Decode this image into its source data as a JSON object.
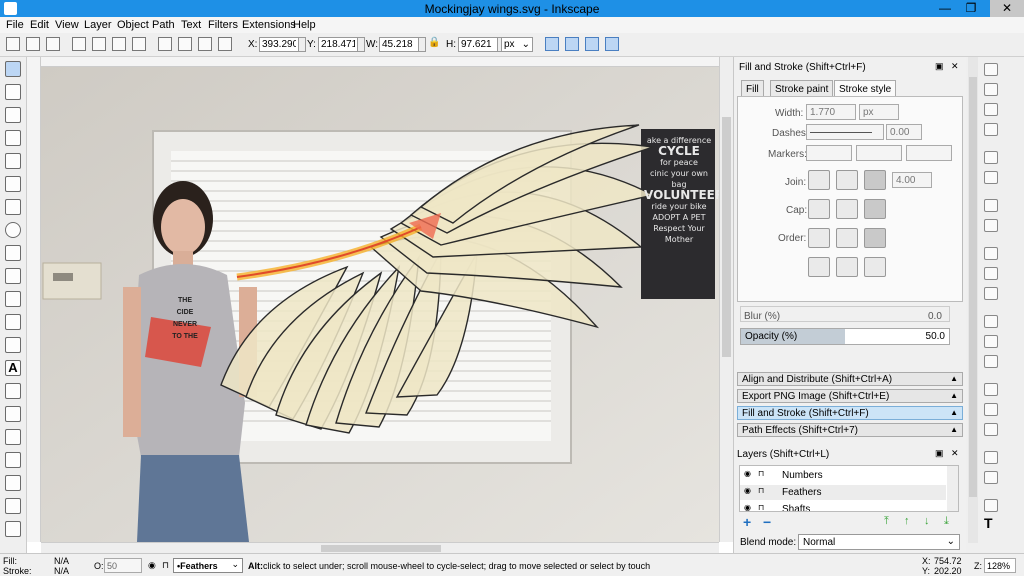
{
  "window": {
    "title": "Mockingjay wings.svg - Inkscape",
    "minimize": "—",
    "maximize": "❐",
    "close": "✕"
  },
  "menu": [
    "File",
    "Edit",
    "View",
    "Layer",
    "Object",
    "Path",
    "Text",
    "Filters",
    "Extensions",
    "Help"
  ],
  "toolbar": {
    "x_label": "X:",
    "x": "393.290",
    "y_label": "Y:",
    "y": "218.471",
    "w_label": "W:",
    "w": "45.218",
    "h_label": "H:",
    "h": "97.621",
    "unit": "px"
  },
  "fill_stroke": {
    "title": "Fill and Stroke (Shift+Ctrl+F)",
    "tabs": [
      "Fill",
      "Stroke paint",
      "Stroke style"
    ],
    "width_label": "Width:",
    "width": "1.770",
    "width_unit": "px",
    "dashes_label": "Dashes:",
    "dashes": "0.00",
    "markers_label": "Markers:",
    "join_label": "Join:",
    "miter": "4.00",
    "cap_label": "Cap:",
    "order_label": "Order:",
    "blur_label": "Blur (%)",
    "blur": "0.0",
    "opacity_label": "Opacity (%)",
    "opacity": "50.0",
    "opacity_fraction": 0.5
  },
  "dock_sections": [
    "Align and Distribute (Shift+Ctrl+A)",
    "Export PNG Image (Shift+Ctrl+E)",
    "Fill and Stroke (Shift+Ctrl+F)",
    "Path Effects  (Shift+Ctrl+7)"
  ],
  "layers": {
    "title": "Layers (Shift+Ctrl+L)",
    "items": [
      "Numbers",
      "Feathers",
      "Shafts"
    ],
    "add": "+",
    "remove": "−",
    "blend_label": "Blend mode:",
    "blend": "Normal"
  },
  "status": {
    "fill_label": "Fill:",
    "fill": "N/A",
    "stroke_label": "Stroke:",
    "stroke": "N/A",
    "o_label": "O:",
    "o": "50",
    "layer": "•Feathers",
    "message_bold": "Alt:",
    "message": " click to select under; scroll mouse-wheel to cycle-select; drag to move selected or select by touch",
    "x_label": "X:",
    "x": "754.72",
    "y_label": "Y:",
    "y": "202.20",
    "z_label": "Z:",
    "zoom": "128%"
  },
  "photo": {
    "sign_lines": [
      "ake a difference",
      "CYCLE",
      "for peace",
      "cinic your own bag",
      "VOLUNTEER",
      "ride your bike",
      "ADOPT A PET",
      "Respect Your Mother"
    ],
    "shirt_lines": [
      "THE",
      "CIDE",
      "NEVER",
      "TO THE"
    ]
  }
}
